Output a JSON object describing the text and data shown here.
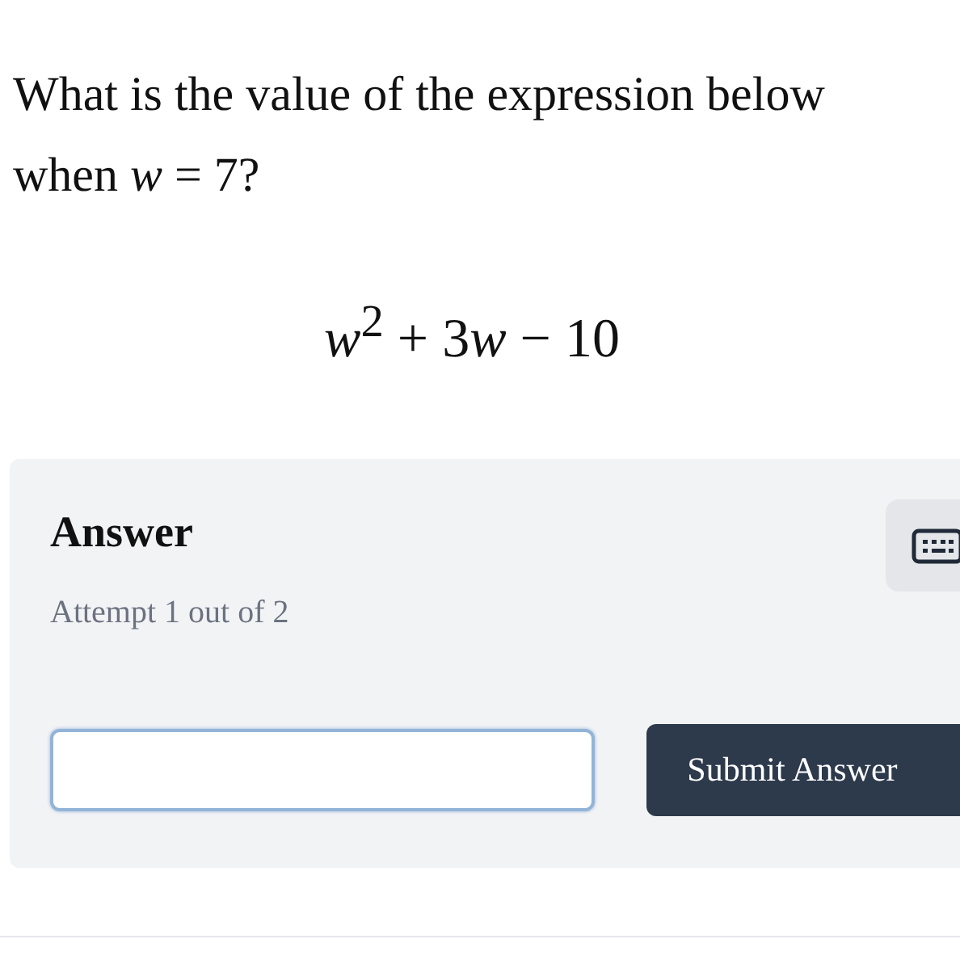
{
  "question": {
    "text": "What is the value of the expression below when *w* = 7?",
    "expression": [
      {
        "kind": "variable",
        "text": "w"
      },
      {
        "kind": "power",
        "text": "2"
      },
      {
        "kind": "plain",
        "text": " + 3"
      },
      {
        "kind": "variable",
        "text": "w"
      },
      {
        "kind": "plain",
        "text": " − 10"
      }
    ]
  },
  "answer_panel": {
    "title": "Answer",
    "attempt": "Attempt 1 out of 2",
    "input": {
      "focused": true
    },
    "submit_button": "Submit Answer"
  }
}
